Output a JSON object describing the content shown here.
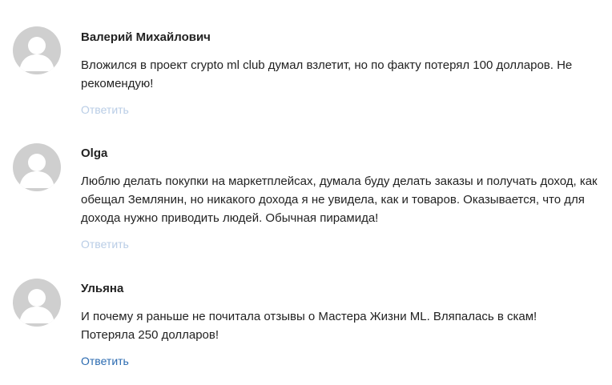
{
  "comments": [
    {
      "author": "Валерий Михайлович",
      "text": "Вложился в проект crypto ml club думал взлетит, но по факту потерял 100 долларов. Не рекомендую!",
      "reply_label": "Ответить",
      "avatar_icon": "default-user-avatar-icon"
    },
    {
      "author": "Olga",
      "text": "Люблю делать покупки на маркетплейсах, думала буду делать заказы и получать доход, как обещал Землянин, но никакого дохода я не увидела, как и товаров. Оказывается, что для дохода нужно приводить людей. Обычная пирамида!",
      "reply_label": "Ответить",
      "avatar_icon": "default-user-avatar-icon"
    },
    {
      "author": "Ульяна",
      "text": "И почему я раньше не почитала отзывы о Мастера Жизни ML. Вляпалась в скам! Потеряла 250 долларов!",
      "reply_label": "Ответить",
      "avatar_icon": "default-user-avatar-icon"
    }
  ],
  "colors": {
    "reply_faded": "#b9cde6",
    "reply_active": "#2a6ab0",
    "avatar_bg": "#cfcfcf",
    "avatar_fg": "#ffffff"
  }
}
